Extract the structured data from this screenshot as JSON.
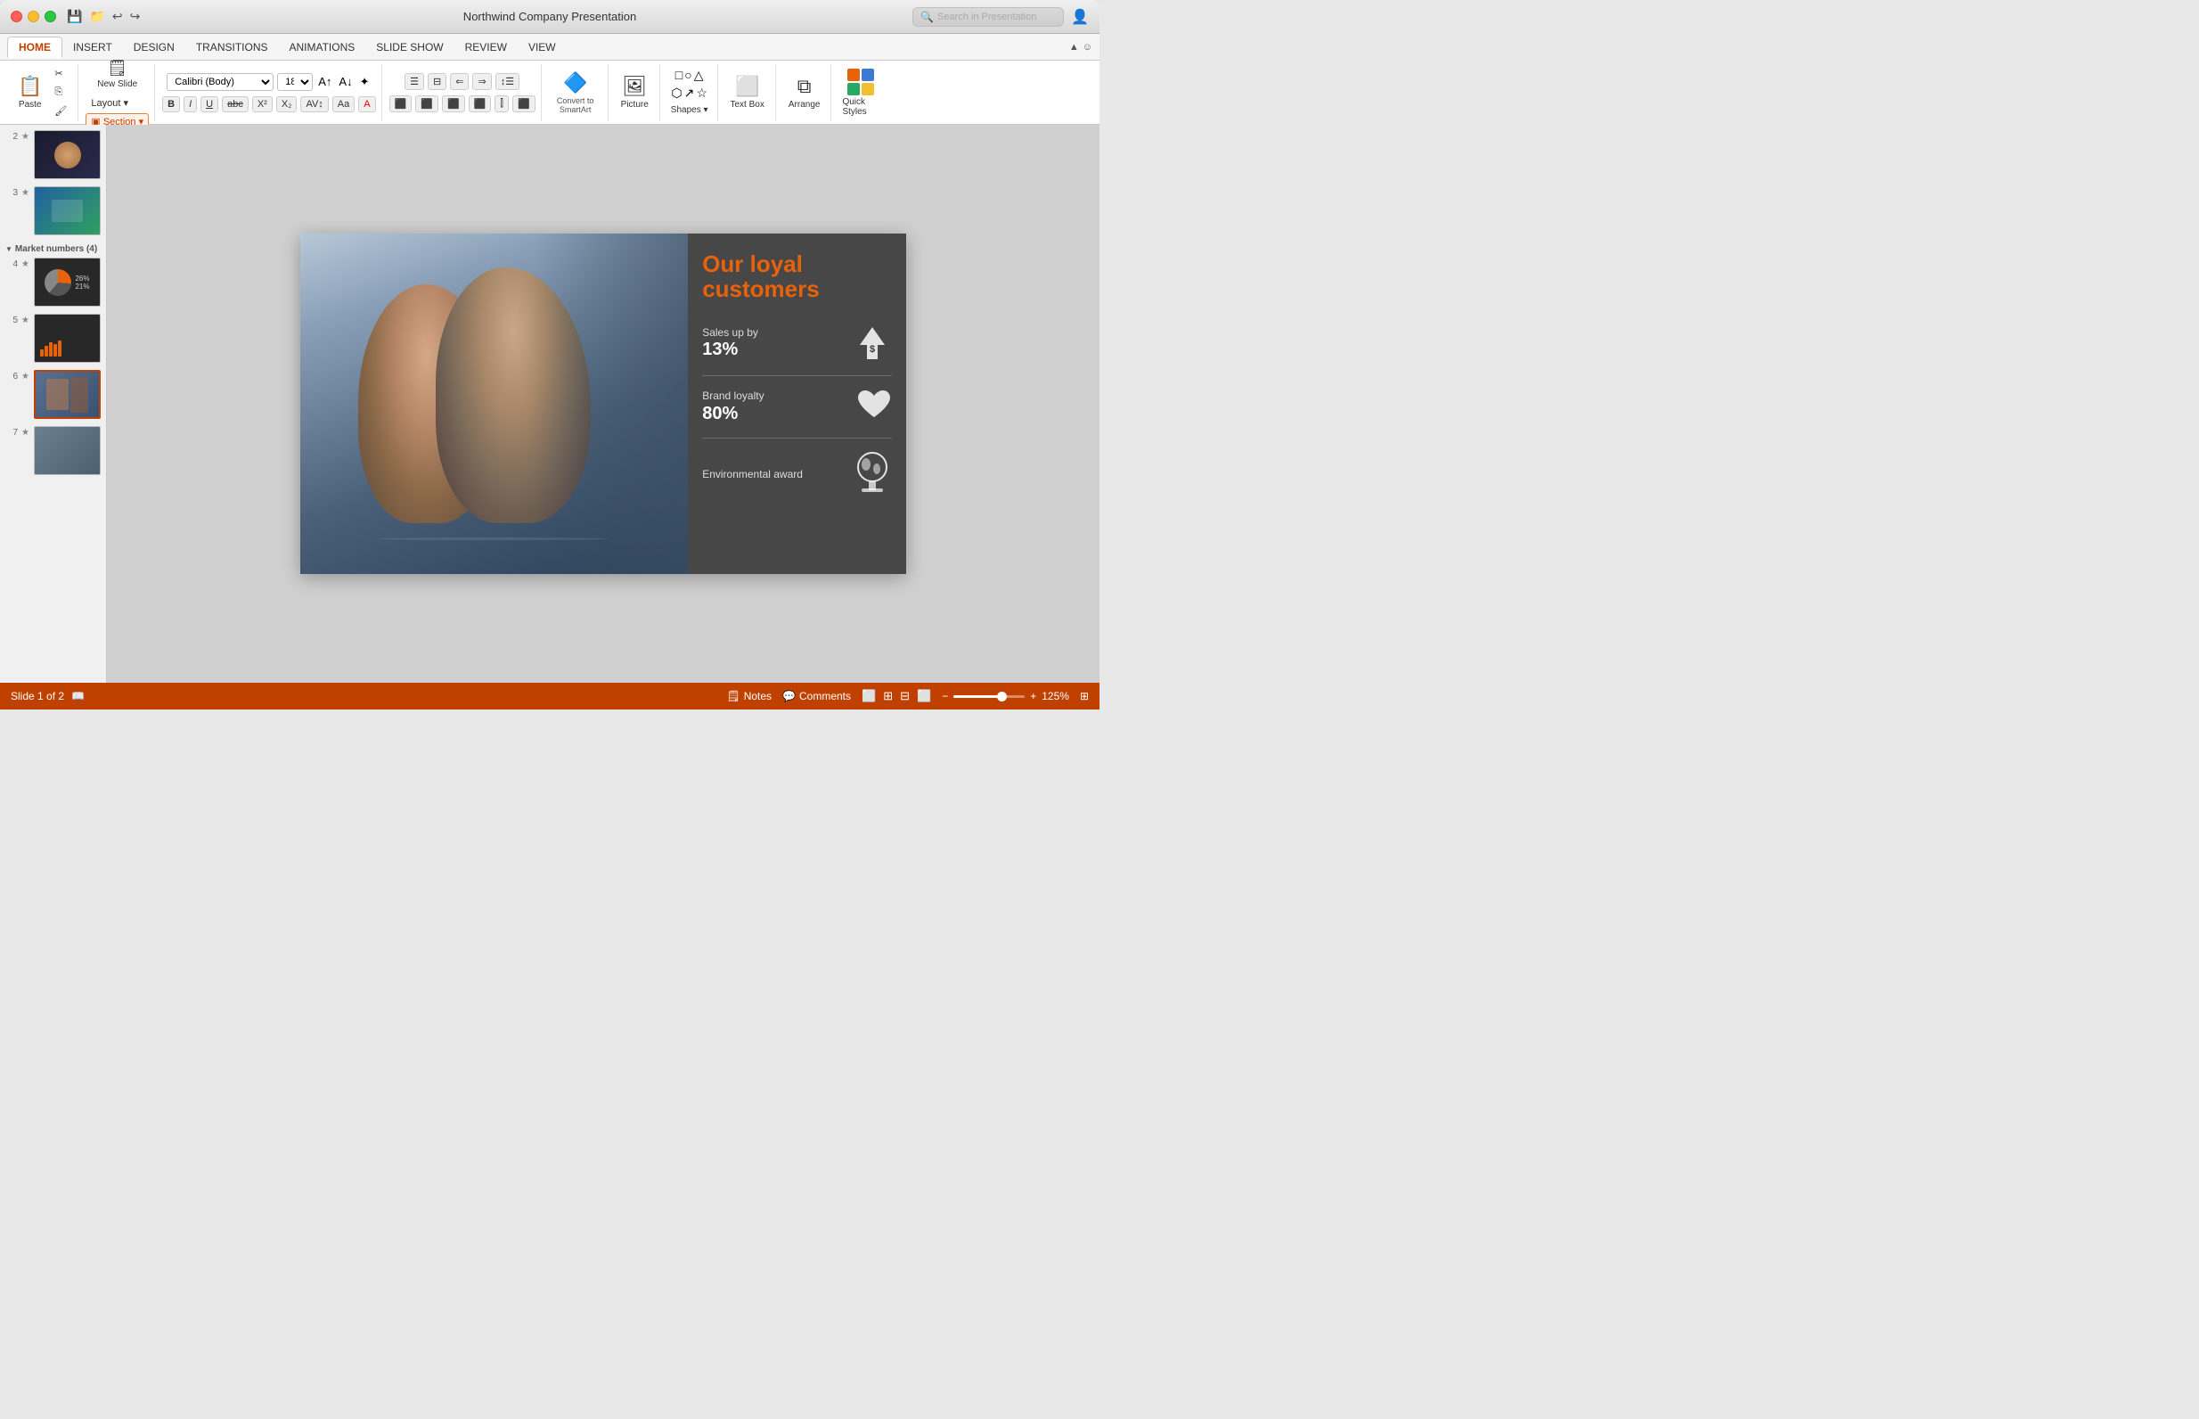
{
  "window": {
    "title": "Northwind Company Presentation"
  },
  "titlebar": {
    "search_placeholder": "Search in Presentation",
    "buttons": [
      "⊞",
      "👤"
    ]
  },
  "tabs": {
    "items": [
      "HOME",
      "INSERT",
      "DESIGN",
      "TRANSITIONS",
      "ANIMATIONS",
      "SLIDE SHOW",
      "REVIEW",
      "VIEW"
    ],
    "active": "HOME"
  },
  "ribbon": {
    "paste_label": "Paste",
    "new_slide_label": "New Slide",
    "layout_label": "Layout ▾",
    "section_label": "Section ▾",
    "font_name": "Calibri (Body)",
    "font_size": "18",
    "bold": "B",
    "italic": "I",
    "underline": "U",
    "strikethrough": "abc",
    "superscript": "X²",
    "subscript": "X₂",
    "char_spacing": "AV↕",
    "change_case": "Aa↓",
    "font_color": "A",
    "align_left": "≡",
    "align_center": "≡",
    "align_right": "≡",
    "justify": "≡",
    "columns": "⫿⫿",
    "convert_smartart": "Convert to SmartArt",
    "picture_label": "Picture",
    "shapes_label": "Shapes ▾",
    "textbox_label": "Text Box",
    "arrange_label": "Arrange",
    "quick_styles_label": "Quick Styles"
  },
  "slides": {
    "current": 1,
    "total": 2,
    "items": [
      {
        "number": "2",
        "star": "★",
        "bg": "t2"
      },
      {
        "number": "3",
        "star": "★",
        "bg": "t3"
      },
      {
        "number": "4",
        "star": "★",
        "bg": "t4"
      },
      {
        "number": "5",
        "star": "★",
        "bg": "t5"
      },
      {
        "number": "6",
        "star": "★",
        "bg": "t6",
        "selected": true
      },
      {
        "number": "7",
        "star": "★",
        "bg": "t7"
      }
    ],
    "section_name": "Market numbers (4)"
  },
  "slide": {
    "title": "Our loyal customers",
    "stats": [
      {
        "label": "Sales up by",
        "value": "13%",
        "icon": "💲"
      },
      {
        "label": "Brand loyalty",
        "value": "80%",
        "icon": "♥"
      },
      {
        "label": "Environmental award",
        "value": "",
        "icon": "🌐"
      }
    ]
  },
  "statusbar": {
    "slide_info": "Slide 1 of 2",
    "notes_label": "Notes",
    "comments_label": "Comments",
    "zoom_level": "125%"
  }
}
